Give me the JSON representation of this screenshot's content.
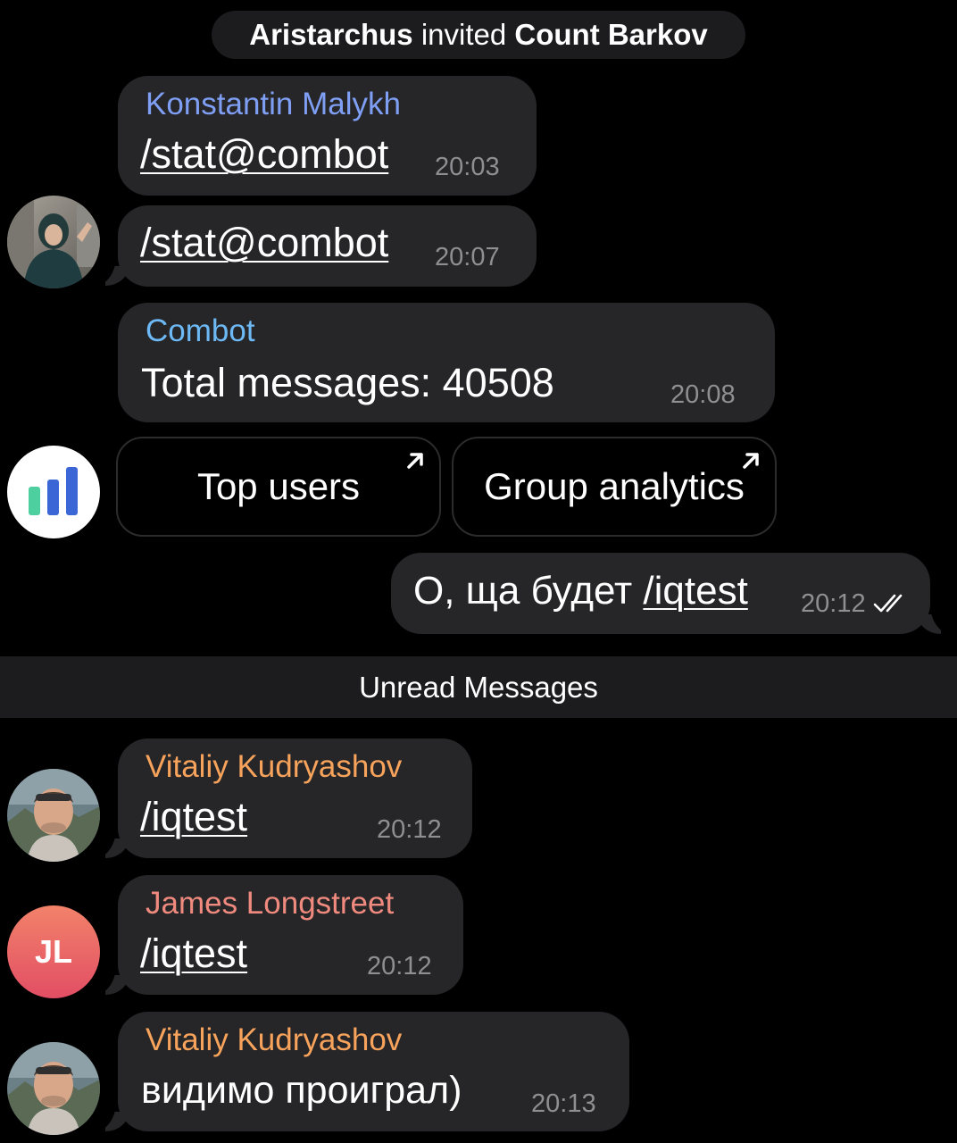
{
  "service": {
    "actor": "Aristarchus",
    "action": "invited",
    "target": "Count Barkov"
  },
  "messages": [
    {
      "sender": "Konstantin Malykh",
      "sender_color": "#7f9ff5",
      "text": "/stat@combot",
      "time": "20:03"
    },
    {
      "sender": "",
      "text": "/stat@combot",
      "time": "20:07"
    },
    {
      "sender": "Combot",
      "sender_color": "#6cb9f5",
      "text": "Total messages: 40508",
      "time": "20:08"
    },
    {
      "sender": "",
      "text_prefix": "О, ща будет ",
      "text_cmd": "/iqtest",
      "time": "20:12",
      "status": "read-double-check"
    },
    {
      "sender": "Vitaliy Kudryashov",
      "sender_color": "#f7a35c",
      "text": "/iqtest",
      "time": "20:12"
    },
    {
      "sender": "James Longstreet",
      "sender_color": "#f08a7e",
      "text": "/iqtest",
      "time": "20:12"
    },
    {
      "sender": "Vitaliy Kudryashov",
      "sender_color": "#f7a35c",
      "text": "видимо проиграл)",
      "time": "20:13"
    }
  ],
  "keyboard": {
    "buttons": [
      {
        "label": "Top users",
        "icon": "external-link-arrow-icon"
      },
      {
        "label": "Group analytics",
        "icon": "external-link-arrow-icon"
      }
    ]
  },
  "divider": {
    "label": "Unread Messages"
  },
  "avatars": {
    "james_initials": "JL",
    "james_gradient": [
      "#f2826a",
      "#e24e64"
    ],
    "combot_bars": [
      "#4dcfa0",
      "#3b66d6",
      "#3b66d6"
    ]
  },
  "colors": {
    "background": "#000000",
    "bubble": "#262628",
    "time": "#8e8e93",
    "pill": "#1c1c1e"
  }
}
